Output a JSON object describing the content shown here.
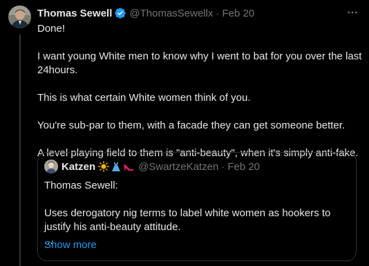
{
  "tweet": {
    "author_name": "Thomas Sewell",
    "author_handle": "@ThomasSewellx",
    "separator": "·",
    "date": "Feb 20",
    "verified_color": "#1d9bf0",
    "more_icon": "ellipsis-icon",
    "paragraphs": [
      "Done!",
      "I want young White men to know why I went to bat for you over the last 24hours.",
      "This is what certain White women think of you.",
      "You're sub-par to them, with a facade they can get someone better.",
      "A level playing field to them is \"anti-beauty\", when it's simply anti-fake."
    ]
  },
  "quoted": {
    "author_name": "Katzen",
    "author_emojis": [
      "sun-emoji",
      "dress-emoji",
      "high-heel-emoji"
    ],
    "author_handle": "@SwartzeKatzen",
    "separator": "·",
    "date": "Feb 20",
    "paragraphs": [
      "Thomas Sewell:",
      "Uses derogatory nig terms to label white women as hookers to justify his anti-beauty attitude.",
      "..."
    ],
    "show_more_label": "Show more",
    "link_color": "#1d9bf0"
  }
}
